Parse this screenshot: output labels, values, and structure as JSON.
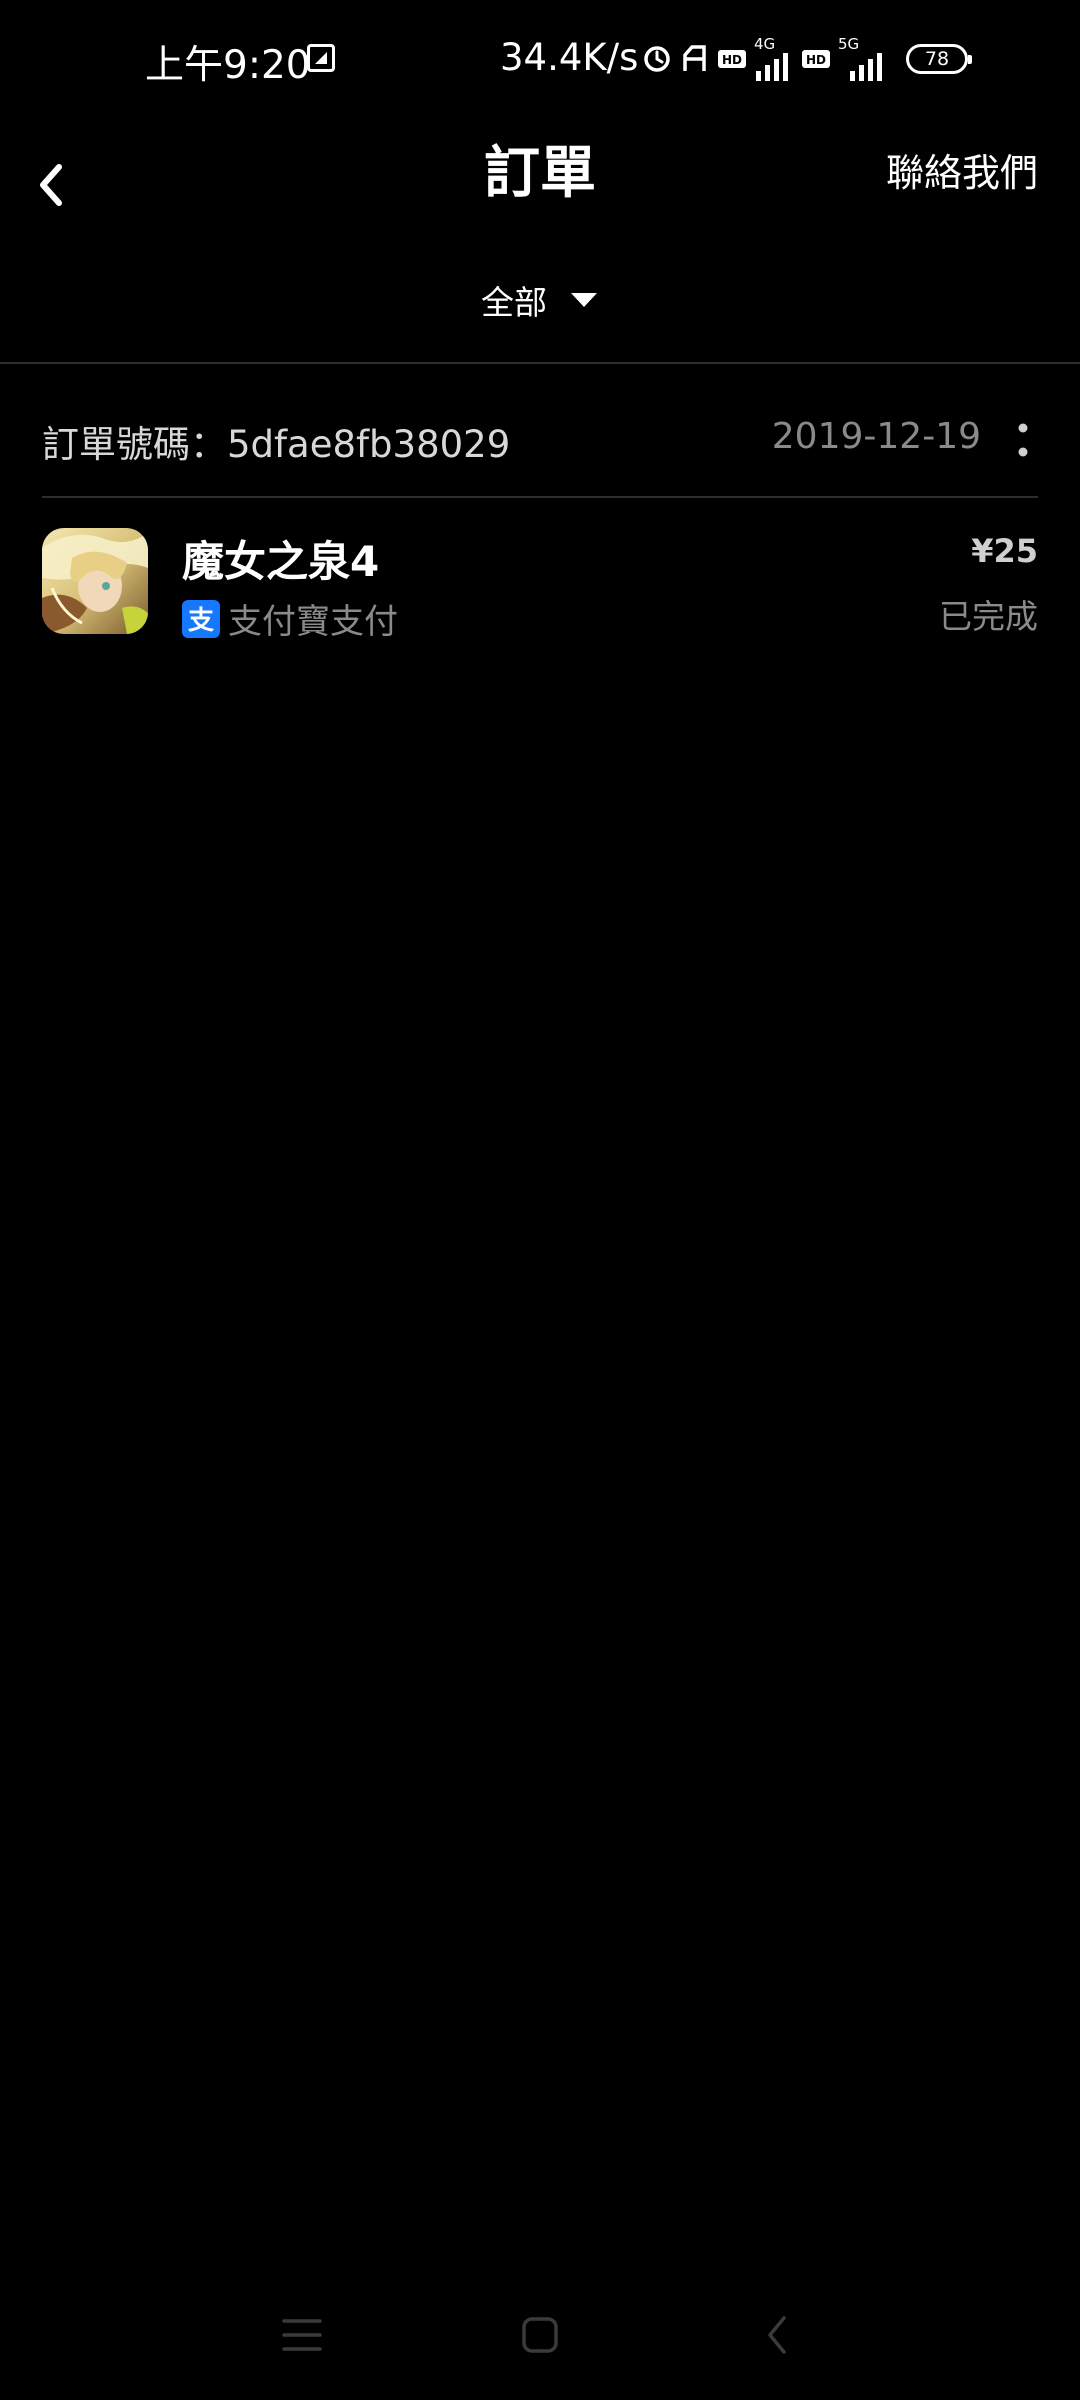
{
  "status_bar": {
    "time": "上午9:20",
    "network_speed": "34.4K/s",
    "net1_label": "4G",
    "net2_label": "5G",
    "battery": "78"
  },
  "header": {
    "title": "訂單",
    "contact_label": "聯絡我們"
  },
  "filter": {
    "selected": "全部"
  },
  "order": {
    "number_text": "訂單號碼：5dfae8fb38029",
    "date": "2019-12-19",
    "item": {
      "name": "魔女之泉4",
      "payment_icon_glyph": "支",
      "payment_method": "支付寶支付",
      "price": "¥25",
      "status": "已完成"
    }
  },
  "colors": {
    "background": "#000000",
    "alipay": "#1677ff",
    "muted_text": "#8a8a8a"
  }
}
